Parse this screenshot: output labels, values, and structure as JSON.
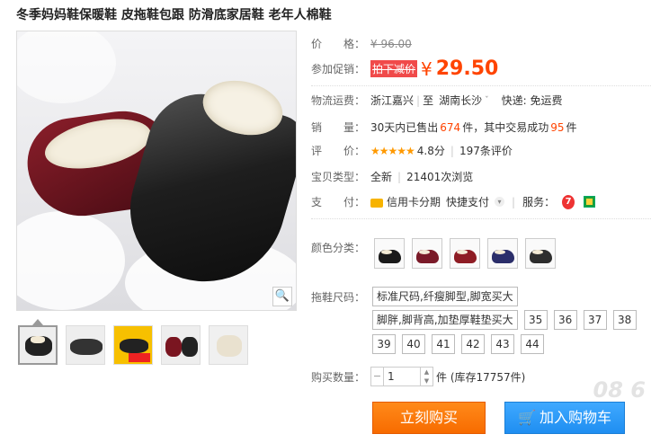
{
  "product": {
    "title": "冬季妈妈鞋保暖鞋 皮拖鞋包跟 防滑底家居鞋 老年人棉鞋"
  },
  "price": {
    "label": "价　　格：",
    "original": "¥ 96.00",
    "promo_label": "参加促销：",
    "promo_tag": "拍下减价",
    "currency": "¥",
    "current": "29.50"
  },
  "shipping": {
    "label": "物流运费：",
    "from": "浙江嘉兴",
    "to_prefix": "至",
    "to": "湖南长沙",
    "express": "快递: 免运费"
  },
  "sales": {
    "label": "销　　量：",
    "prefix": "30天内已售出",
    "sold": "674",
    "mid": "件，其中交易成功",
    "success": "95",
    "suffix": "件"
  },
  "rating": {
    "label": "评　　价：",
    "stars": "★★★★★",
    "score": "4.8分",
    "reviews": "197条评价"
  },
  "type": {
    "label": "宝贝类型：",
    "condition": "全新",
    "views": "21401次浏览"
  },
  "payment": {
    "label": "支　　付：",
    "credit": "信用卡分期",
    "quick": "快捷支付",
    "service_label": "服务："
  },
  "color": {
    "label": "颜色分类："
  },
  "size": {
    "label": "拖鞋尺码：",
    "option_wide": "标准尺码,纤瘦脚型,脚宽买大",
    "option_fat": "脚胖,脚背高,加垫厚鞋垫买大",
    "numbers": [
      "35",
      "36",
      "37",
      "38",
      "39",
      "40",
      "41",
      "42",
      "43",
      "44"
    ]
  },
  "quantity": {
    "label": "购买数量：",
    "value": "1",
    "stock": "件 (库存17757件)"
  },
  "actions": {
    "buy": "立刻购买",
    "cart": "加入购物车"
  },
  "watermark": "08 6"
}
